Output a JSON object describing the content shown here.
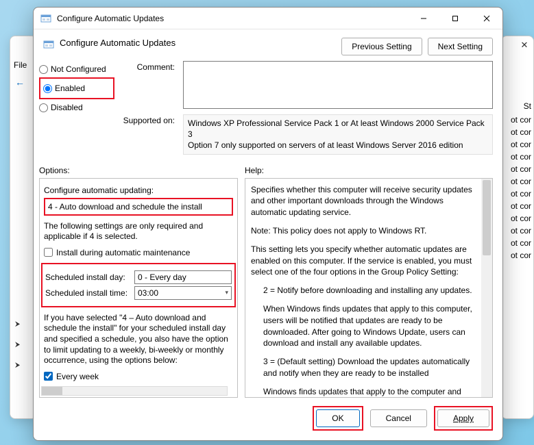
{
  "background": {
    "close": "✕",
    "menu": "File",
    "back": "←",
    "status_header": "St",
    "status_rows": [
      "ot cor",
      "ot cor",
      "ot cor",
      "ot cor",
      "ot cor",
      "ot cor",
      "ot cor",
      "ot cor",
      "ot cor",
      "ot cor",
      "ot cor",
      "ot cor"
    ]
  },
  "titlebar": {
    "text": "Configure Automatic Updates"
  },
  "header": {
    "title": "Configure Automatic Updates",
    "previous": "Previous Setting",
    "next": "Next Setting"
  },
  "radios": {
    "not_configured": "Not Configured",
    "enabled": "Enabled",
    "disabled": "Disabled"
  },
  "comment_label": "Comment:",
  "comment_value": "",
  "supported_label": "Supported on:",
  "supported_text": "Windows XP Professional Service Pack 1 or At least Windows 2000 Service Pack 3\nOption 7 only supported on servers of at least Windows Server 2016 edition",
  "section": {
    "options": "Options:",
    "help": "Help:"
  },
  "options": {
    "configure_label": "Configure automatic updating:",
    "configure_value": "4 - Auto download and schedule the install",
    "following_text": "The following settings are only required and applicable if 4 is selected.",
    "install_maint": "Install during automatic maintenance",
    "install_maint_checked": false,
    "sched_day_label": "Scheduled install day:",
    "sched_day_value": "0 - Every day",
    "sched_time_label": "Scheduled install time:",
    "sched_time_value": "03:00",
    "if_selected_text": "If you have selected \"4 – Auto download and schedule the install\" for your scheduled install day and specified a schedule, you also have the option to limit updating to a weekly, bi-weekly or monthly occurrence, using the options below:",
    "every_week": "Every week",
    "every_week_checked": true
  },
  "help": {
    "p1": "Specifies whether this computer will receive security updates and other important downloads through the Windows automatic updating service.",
    "p2": "Note: This policy does not apply to Windows RT.",
    "p3": "This setting lets you specify whether automatic updates are enabled on this computer. If the service is enabled, you must select one of the four options in the Group Policy Setting:",
    "p4": "2 = Notify before downloading and installing any updates.",
    "p5": "When Windows finds updates that apply to this computer, users will be notified that updates are ready to be downloaded. After going to Windows Update, users can download and install any available updates.",
    "p6": "3 = (Default setting) Download the updates automatically and notify when they are ready to be installed",
    "p7": "Windows finds updates that apply to the computer and"
  },
  "footer": {
    "ok": "OK",
    "cancel": "Cancel",
    "apply": "Apply"
  }
}
